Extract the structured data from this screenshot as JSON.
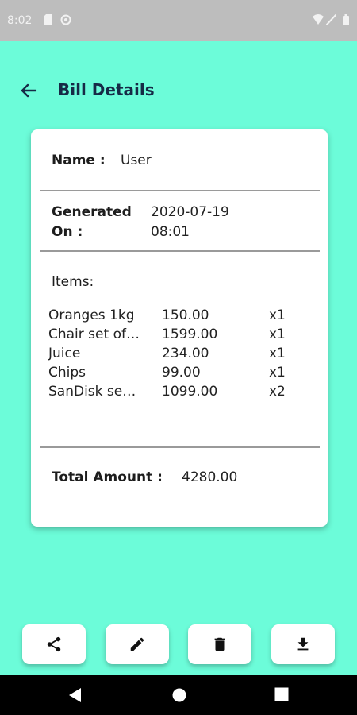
{
  "status": {
    "time": "8:02"
  },
  "header": {
    "title": "Bill Details"
  },
  "bill": {
    "name_label": "Name :",
    "name_value": "User",
    "generated_label_1": "Generated",
    "generated_label_2": "On :",
    "date": "2020-07-19",
    "time": "08:01",
    "items_label": "Items:",
    "items": [
      {
        "name": "Oranges 1kg",
        "price": "150.00",
        "qty": "x1"
      },
      {
        "name": "Chair set of…",
        "price": "1599.00",
        "qty": "x1"
      },
      {
        "name": "Juice",
        "price": "234.00",
        "qty": "x1"
      },
      {
        "name": "Chips",
        "price": "99.00",
        "qty": "x1"
      },
      {
        "name": "SanDisk se…",
        "price": "1099.00",
        "qty": "x2"
      }
    ],
    "total_label": "Total Amount :",
    "total_value": "4280.00"
  },
  "actions": [
    {
      "icon": "share-icon"
    },
    {
      "icon": "edit-icon"
    },
    {
      "icon": "delete-icon"
    },
    {
      "icon": "download-icon"
    }
  ],
  "theme": {
    "background": "#6cfcd9",
    "title_color": "#162a46"
  }
}
